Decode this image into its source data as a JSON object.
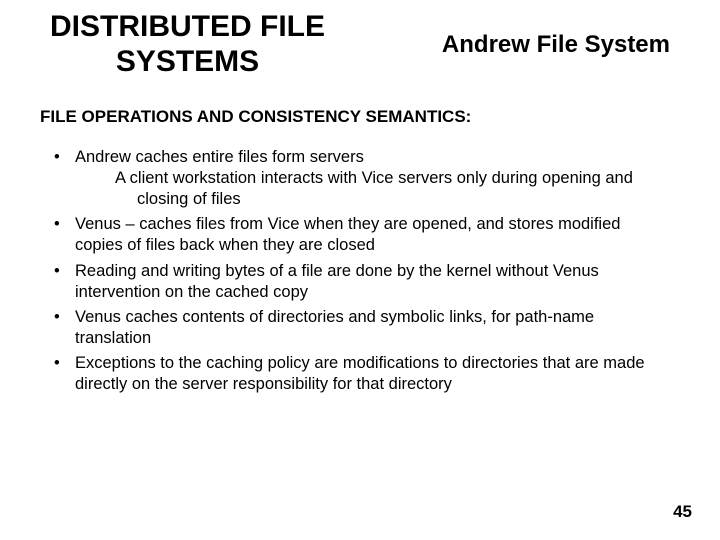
{
  "header": {
    "title_left_line1": "DISTRIBUTED FILE",
    "title_left_line2": "SYSTEMS",
    "title_right": "Andrew File System"
  },
  "section_heading": "FILE OPERATIONS AND CONSISTENCY SEMANTICS:",
  "bullets": [
    {
      "text": "Andrew caches entire files form servers",
      "sub1": "A client workstation interacts with Vice servers only during opening and",
      "sub2": "closing of files"
    },
    {
      "text": "Venus – caches files from Vice when they are opened, and stores modified copies of files back when they are closed"
    },
    {
      "text": "Reading and writing bytes of a file are done by the kernel without Venus intervention on the cached copy"
    },
    {
      "text": "Venus caches contents of directories and symbolic links, for path-name translation"
    },
    {
      "text": "Exceptions to the caching policy are modifications to directories that are made directly on the server responsibility for that directory"
    }
  ],
  "page_number": "45"
}
